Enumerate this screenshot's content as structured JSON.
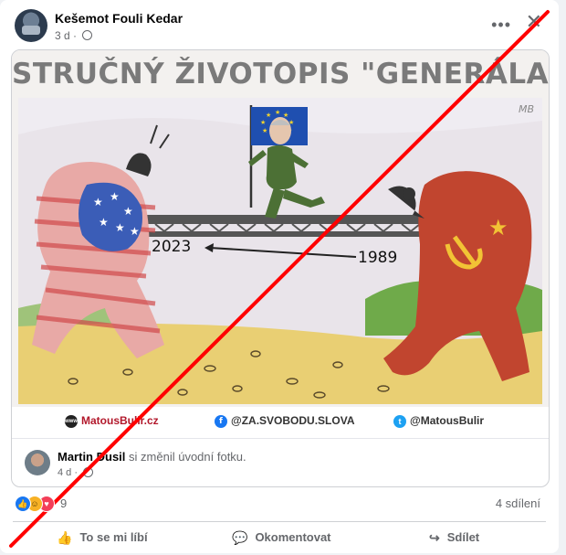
{
  "post": {
    "author": "Kešemot Fouli Kedar",
    "time": "3 d",
    "privacy_icon": "globe-icon",
    "more_icon": "more-options-icon",
    "close_icon": "close-icon"
  },
  "meme": {
    "title": "STRUČNÝ ŽIVOTOPIS \"GENERÁLA\" PAVLA",
    "signature": "MB",
    "year_left": "2023",
    "year_right": "1989",
    "credits": {
      "website": "MatousBulir.cz",
      "facebook": "@ZA.SVOBODU.SLOVA",
      "twitter": "@MatousBulir"
    }
  },
  "shared": {
    "name": "Martin Dusil",
    "action": "si změnil úvodní fotku.",
    "time": "4 d"
  },
  "stats": {
    "reaction_icons": [
      "like-icon",
      "haha-icon",
      "love-icon"
    ],
    "reaction_count": "9",
    "shares": "4 sdílení"
  },
  "actions": {
    "like": "To se mi líbí",
    "comment": "Okomentovat",
    "share": "Sdílet"
  },
  "colors": {
    "strike_line": "#ff0000",
    "link_blue": "#1877f2",
    "muted": "#65676b"
  }
}
